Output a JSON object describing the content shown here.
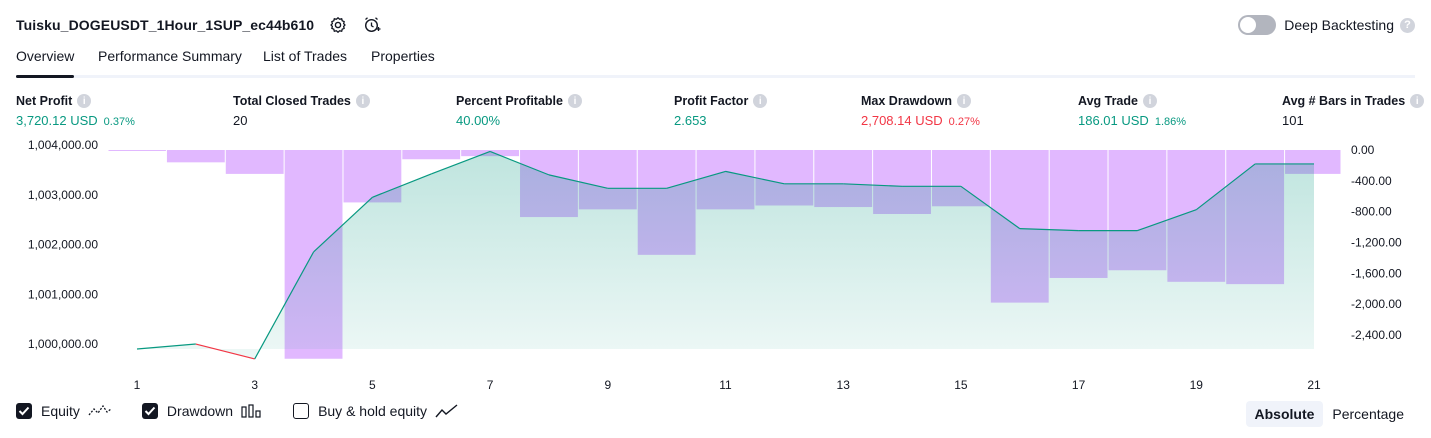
{
  "header": {
    "title": "Tuisku_DOGEUSDT_1Hour_1SUP_ec44b610",
    "deep_backtesting_label": "Deep Backtesting",
    "deep_backtesting_enabled": false,
    "help_glyph": "?"
  },
  "tabs": [
    {
      "label": "Overview",
      "active": true
    },
    {
      "label": "Performance Summary",
      "active": false
    },
    {
      "label": "List of Trades",
      "active": false
    },
    {
      "label": "Properties",
      "active": false
    }
  ],
  "metrics": [
    {
      "label": "Net Profit",
      "value": "3,720.12 USD",
      "pct": "0.37%",
      "color": "green"
    },
    {
      "label": "Total Closed Trades",
      "value": "20",
      "pct": "",
      "color": "dark"
    },
    {
      "label": "Percent Profitable",
      "value": "40.00%",
      "pct": "",
      "color": "green"
    },
    {
      "label": "Profit Factor",
      "value": "2.653",
      "pct": "",
      "color": "green"
    },
    {
      "label": "Max Drawdown",
      "value": "2,708.14 USD",
      "pct": "0.27%",
      "color": "red"
    },
    {
      "label": "Avg Trade",
      "value": "186.01 USD",
      "pct": "1.86%",
      "color": "green"
    },
    {
      "label": "Avg # Bars in Trades",
      "value": "101",
      "pct": "",
      "color": "dark"
    }
  ],
  "chart_data": {
    "type": "line",
    "x_ticks": [
      "1",
      "3",
      "5",
      "7",
      "9",
      "11",
      "13",
      "15",
      "17",
      "19",
      "21"
    ],
    "left_axis": {
      "ticks": [
        "1,004,000.00",
        "1,003,000.00",
        "1,002,000.00",
        "1,001,000.00",
        "1,000,000.00"
      ],
      "tick_values": [
        1004000,
        1003000,
        1002000,
        1001000,
        1000000
      ],
      "ylim": [
        999800,
        1004000
      ]
    },
    "right_axis": {
      "ticks": [
        "0.00",
        "-400.00",
        "-800.00",
        "-1,200.00",
        "-1,600.00",
        "-2,000.00",
        "-2,400.00"
      ],
      "tick_values": [
        0,
        -400,
        -800,
        -1200,
        -1600,
        -2000,
        -2400
      ],
      "ylim": [
        -2708.14,
        0
      ]
    },
    "series": [
      {
        "name": "Equity",
        "axis": "left",
        "color": "#089981",
        "x": [
          1,
          2,
          3,
          4,
          5,
          6,
          7,
          8,
          9,
          10,
          11,
          12,
          13,
          14,
          15,
          16,
          17,
          18,
          19,
          20,
          21
        ],
        "values": [
          1000000,
          1000100,
          999800,
          1001950,
          1003050,
          1003520,
          1003970,
          1003500,
          1003230,
          1003230,
          1003570,
          1003320,
          1003320,
          1003270,
          1003270,
          1002420,
          1002380,
          1002380,
          1002800,
          1003720,
          1003720
        ]
      },
      {
        "name": "Drawdown",
        "axis": "right",
        "color": "#e1b8ff",
        "x": [
          1,
          2,
          3,
          4,
          5,
          6,
          7,
          8,
          9,
          10,
          11,
          12,
          13,
          14,
          15,
          16,
          17,
          18,
          19,
          20,
          21
        ],
        "values": [
          0,
          -160,
          -310,
          -2708.14,
          -680,
          -120,
          -80,
          -870,
          -770,
          -1360,
          -770,
          -720,
          -740,
          -830,
          -730,
          -1980,
          -1660,
          -1560,
          -1710,
          -1740,
          -310
        ]
      }
    ]
  },
  "legend": {
    "items": [
      {
        "label": "Equity",
        "checked": true
      },
      {
        "label": "Drawdown",
        "checked": true
      },
      {
        "label": "Buy & hold equity",
        "checked": false
      }
    ]
  },
  "mode": {
    "absolute_label": "Absolute",
    "percentage_label": "Percentage",
    "selected": "Absolute"
  },
  "colors": {
    "green": "#089981",
    "red": "#f23645",
    "drawdown": "#e1b8ff",
    "text": "#131722"
  }
}
